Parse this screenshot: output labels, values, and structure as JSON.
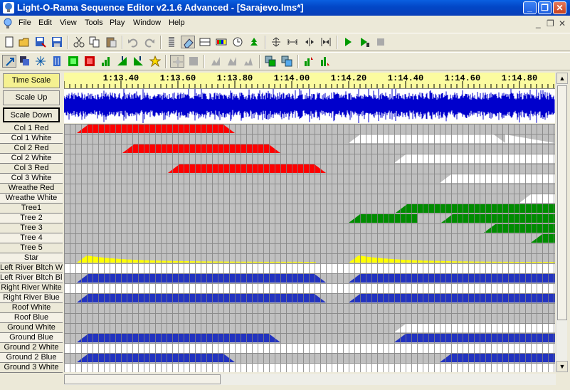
{
  "window": {
    "title": "Light-O-Rama Sequence Editor v2.1.6 Advanced - [Sarajevo.lms*]",
    "minimize_label": "_",
    "restore_label": "❐",
    "close_label": "✕"
  },
  "menu": {
    "items": [
      "File",
      "Edit",
      "View",
      "Tools",
      "Play",
      "Window",
      "Help"
    ],
    "mdi_controls": [
      "_",
      "❐",
      "✕"
    ]
  },
  "toolbar1_icons": [
    "new-icon",
    "open-icon",
    "save-as-icon",
    "save-icon",
    "cut-icon",
    "copy-icon",
    "paste-icon",
    "undo-icon",
    "redo-icon",
    "channel-grid-icon",
    "eraser-icon",
    "row-icon",
    "color-bar-icon",
    "timing-icon",
    "tree-icon",
    "fit-icon",
    "zoom-icon",
    "split-icon",
    "shrink-icon",
    "play-icon",
    "play-from-icon",
    "stop-icon"
  ],
  "toolbar2_icons": [
    "select-icon",
    "copy-cells-icon",
    "sparkle-icon",
    "twinkle-icon",
    "on-icon",
    "off-icon",
    "ramp-up-icon",
    "ramp-down-icon",
    "fade-icon",
    "shimmer-icon",
    "star-icon",
    "effect1-icon",
    "effect2-icon",
    "effect3-icon",
    "effect4-icon",
    "window1-icon",
    "window2-icon",
    "graph1-icon",
    "graph2-icon"
  ],
  "side_buttons": {
    "time_scale": "Time Scale",
    "scale_up": "Scale Up",
    "scale_down": "Scale Down"
  },
  "ruler": {
    "labels": [
      "1:13.40",
      "1:13.60",
      "1:13.80",
      "1:14.00",
      "1:14.20",
      "1:14.40",
      "1:14.60",
      "1:14.80"
    ]
  },
  "channels": [
    {
      "label": "Col 1 Red"
    },
    {
      "label": "Col 1 White"
    },
    {
      "label": "Col 2 Red"
    },
    {
      "label": "Col 2 White"
    },
    {
      "label": "Col 3 Red"
    },
    {
      "label": "Col 3 White"
    },
    {
      "label": "Wreathe Red"
    },
    {
      "label": "Wreathe White"
    },
    {
      "label": "Tree1"
    },
    {
      "label": "Tree 2"
    },
    {
      "label": "Tree 3"
    },
    {
      "label": "Tree 4"
    },
    {
      "label": "Tree 5"
    },
    {
      "label": "Star"
    },
    {
      "label": "Left River Bltch White"
    },
    {
      "label": "Left River Bltch Blue"
    },
    {
      "label": "Right River White"
    },
    {
      "label": "Right River Blue"
    },
    {
      "label": "Roof White"
    },
    {
      "label": "Roof Blue"
    },
    {
      "label": "Ground White"
    },
    {
      "label": "Ground Blue"
    },
    {
      "label": "Ground 2 White"
    },
    {
      "label": "Ground 2 Blue"
    },
    {
      "label": "Ground 3 White"
    }
  ],
  "colors": {
    "red": "#ff0000",
    "white": "#ffffff",
    "green": "#008c00",
    "yellow": "#ffff00",
    "blue": "#2233c0",
    "grid_bg": "#c0c0c0",
    "grid_line": "#808080",
    "waveform": "#0000cc"
  }
}
